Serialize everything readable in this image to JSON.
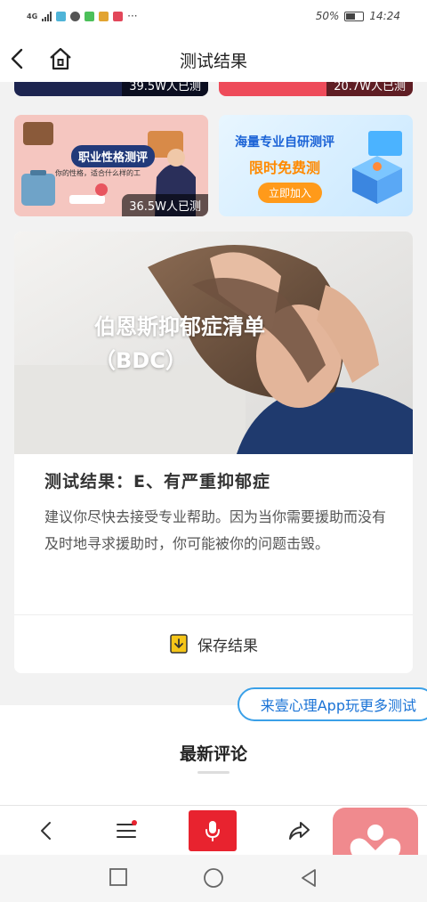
{
  "status_bar": {
    "network": "4G",
    "battery": "50%",
    "time": "14:24",
    "more": "···"
  },
  "nav": {
    "title": "测试结果"
  },
  "banners": {
    "top_left_count": "39.5W人已测",
    "top_right_count": "20.7W人已测",
    "career": {
      "title": "职业性格测评",
      "subtitle": "你的性格，适合什么样的工",
      "count": "36.5W人已测"
    },
    "free": {
      "title": "海量专业自研测评",
      "subtitle": "限时免费测",
      "button": "立即加入"
    }
  },
  "result_card": {
    "hero_title_line1": "伯恩斯抑郁症清单",
    "hero_title_line2": "（BDC）",
    "result_title": "测试结果：E、有严重抑郁症",
    "result_desc": "建议你尽快去接受专业帮助。因为当你需要援助而没有及时地寻求援助时，你可能被你的问题击毁。",
    "save_label": "保存结果"
  },
  "app_link": "来壹心理App玩更多测试",
  "comments": {
    "title": "最新评论"
  },
  "colors": {
    "accent_red": "#e8232f",
    "link_blue": "#1a73d6",
    "fab_pink": "#f08a8e"
  },
  "icons": {
    "back": "chevron-left-icon",
    "home": "home-icon",
    "save": "download-file-icon",
    "menu": "menu-icon",
    "mic": "microphone-icon",
    "share": "share-icon",
    "app_fab": "heart-person-icon"
  }
}
